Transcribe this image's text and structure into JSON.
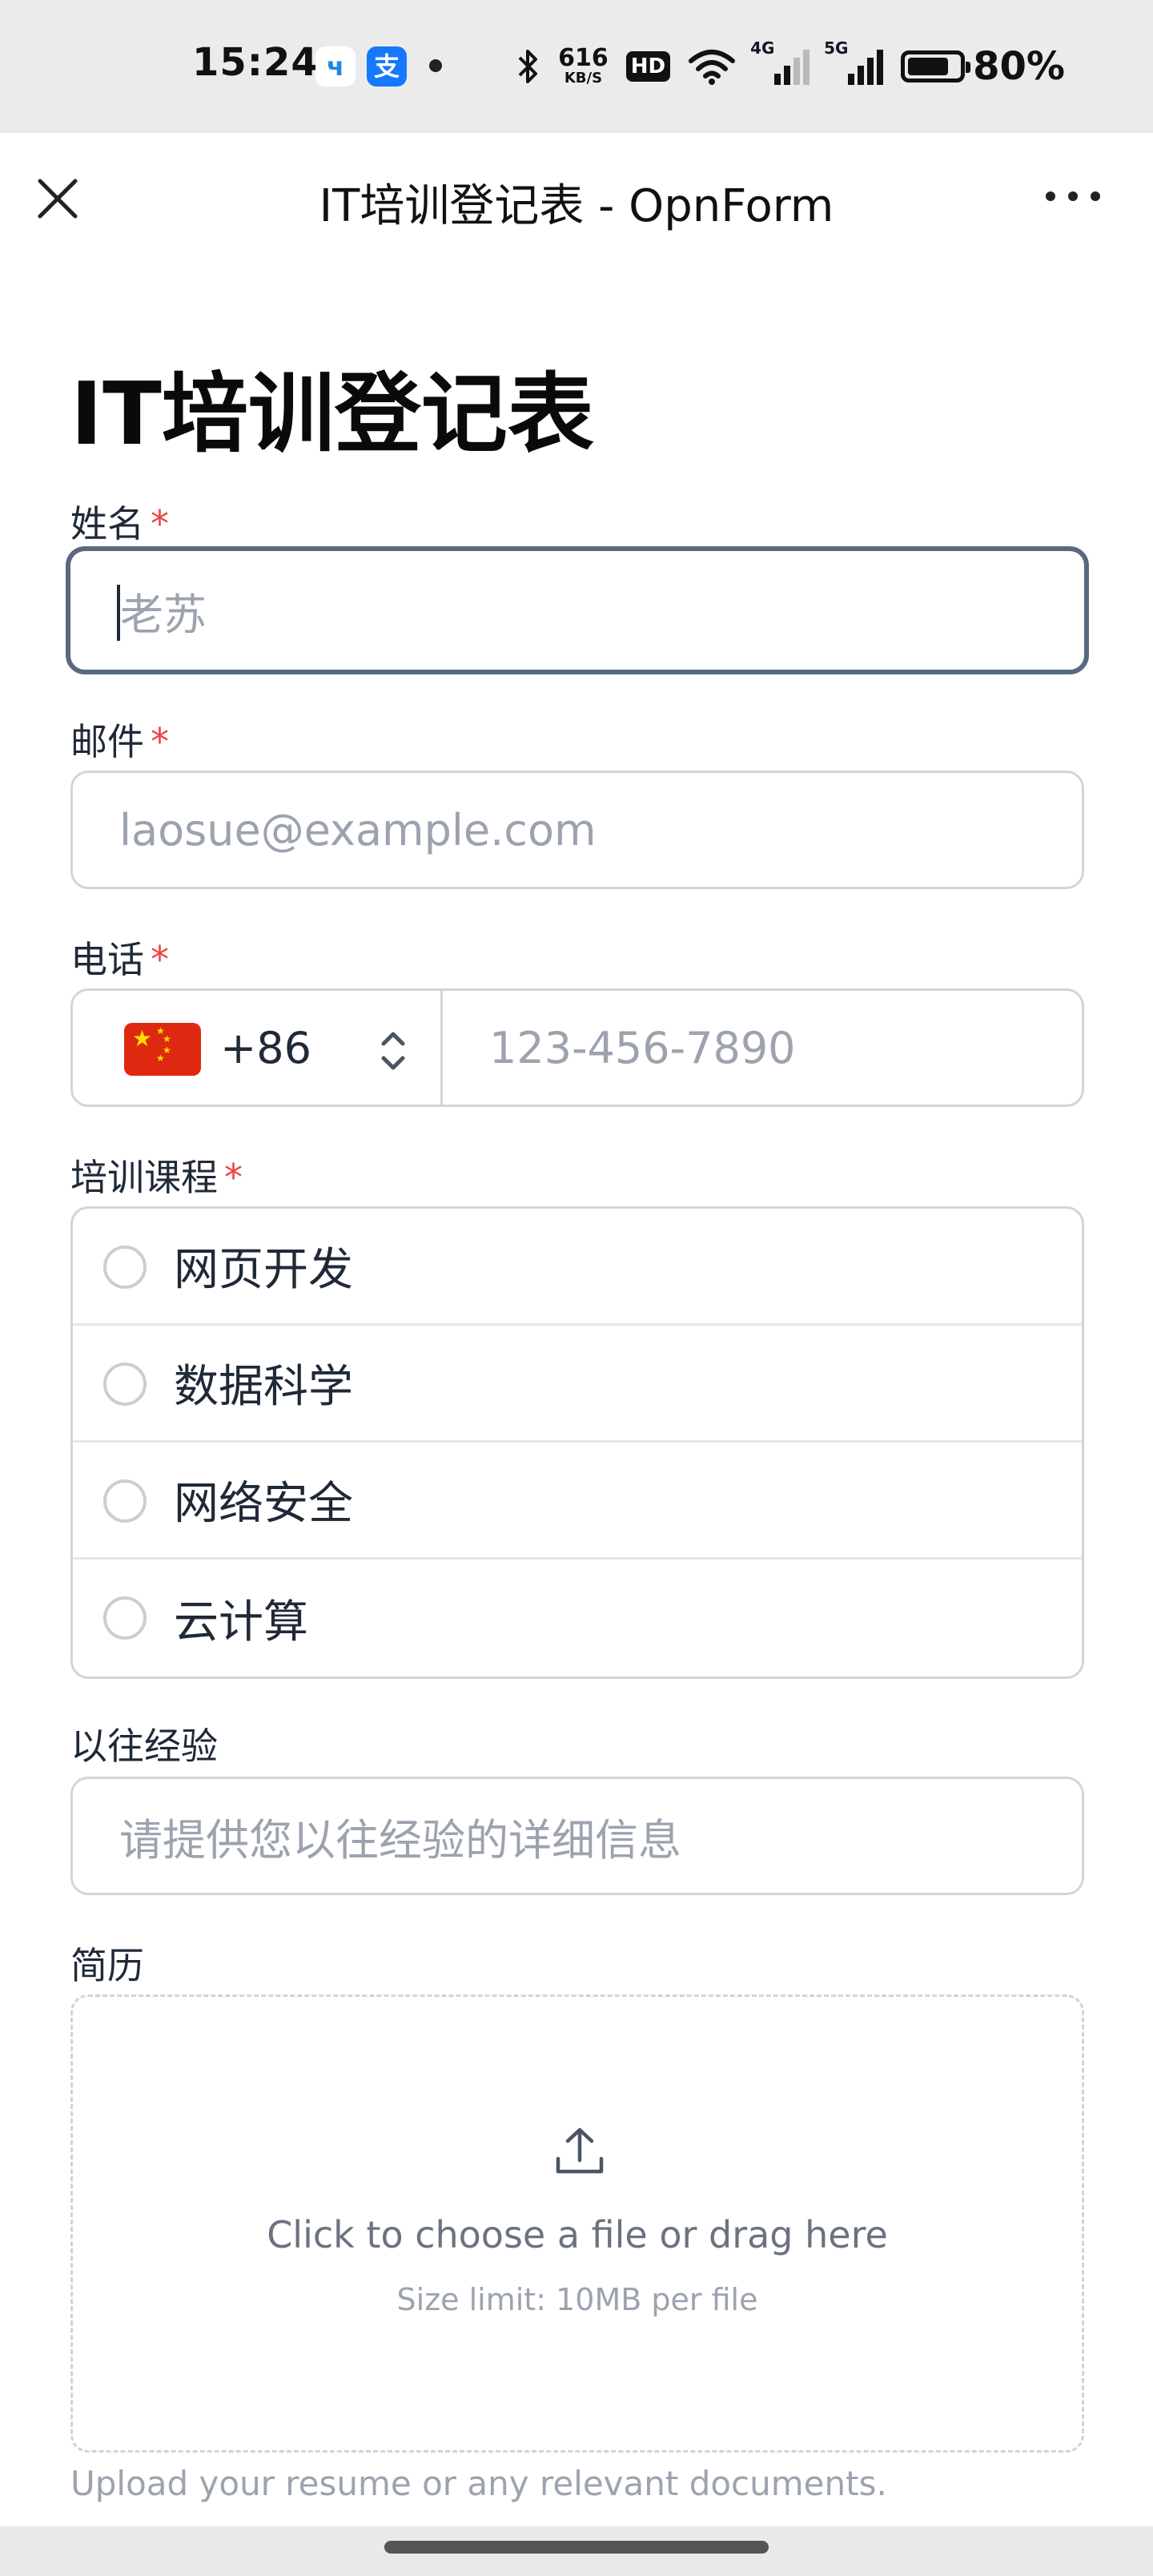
{
  "status_bar": {
    "time": "15:24",
    "app_icons": [
      {
        "name": "china-telecom-app-icon",
        "glyph": "ч"
      },
      {
        "name": "alipay-app-icon",
        "glyph": "支"
      }
    ],
    "net_speed_value": "616",
    "net_speed_unit": "KB/S",
    "hd_label": "HD",
    "signal_1_tag": "4G",
    "signal_2_tag": "5G",
    "battery_percent": "80%",
    "battery_level": 0.8
  },
  "title_bar": {
    "title": "IT培训登记表 - OpnForm"
  },
  "form": {
    "title": "IT培训登记表",
    "required_mark": "*",
    "name": {
      "label": "姓名",
      "placeholder": "老苏"
    },
    "email": {
      "label": "邮件",
      "placeholder": "laosue@example.com"
    },
    "phone": {
      "label": "电话",
      "country_flag": "China",
      "dial_code": "+86",
      "placeholder": "123-456-7890"
    },
    "course": {
      "label": "培训课程",
      "options": [
        "网页开发",
        "数据科学",
        "网络安全",
        "云计算"
      ]
    },
    "experience": {
      "label": "以往经验",
      "placeholder": "请提供您以往经验的详细信息"
    },
    "resume": {
      "label": "简历",
      "upload_text": "Click to choose a file or drag here",
      "size_limit": "Size limit: 10MB per file",
      "help_text": "Upload your resume or any relevant documents."
    }
  },
  "colors": {
    "required": "#ef4444",
    "focused_border": "#5a6a7e",
    "border": "#d1d5db",
    "placeholder": "#9ca3af"
  }
}
